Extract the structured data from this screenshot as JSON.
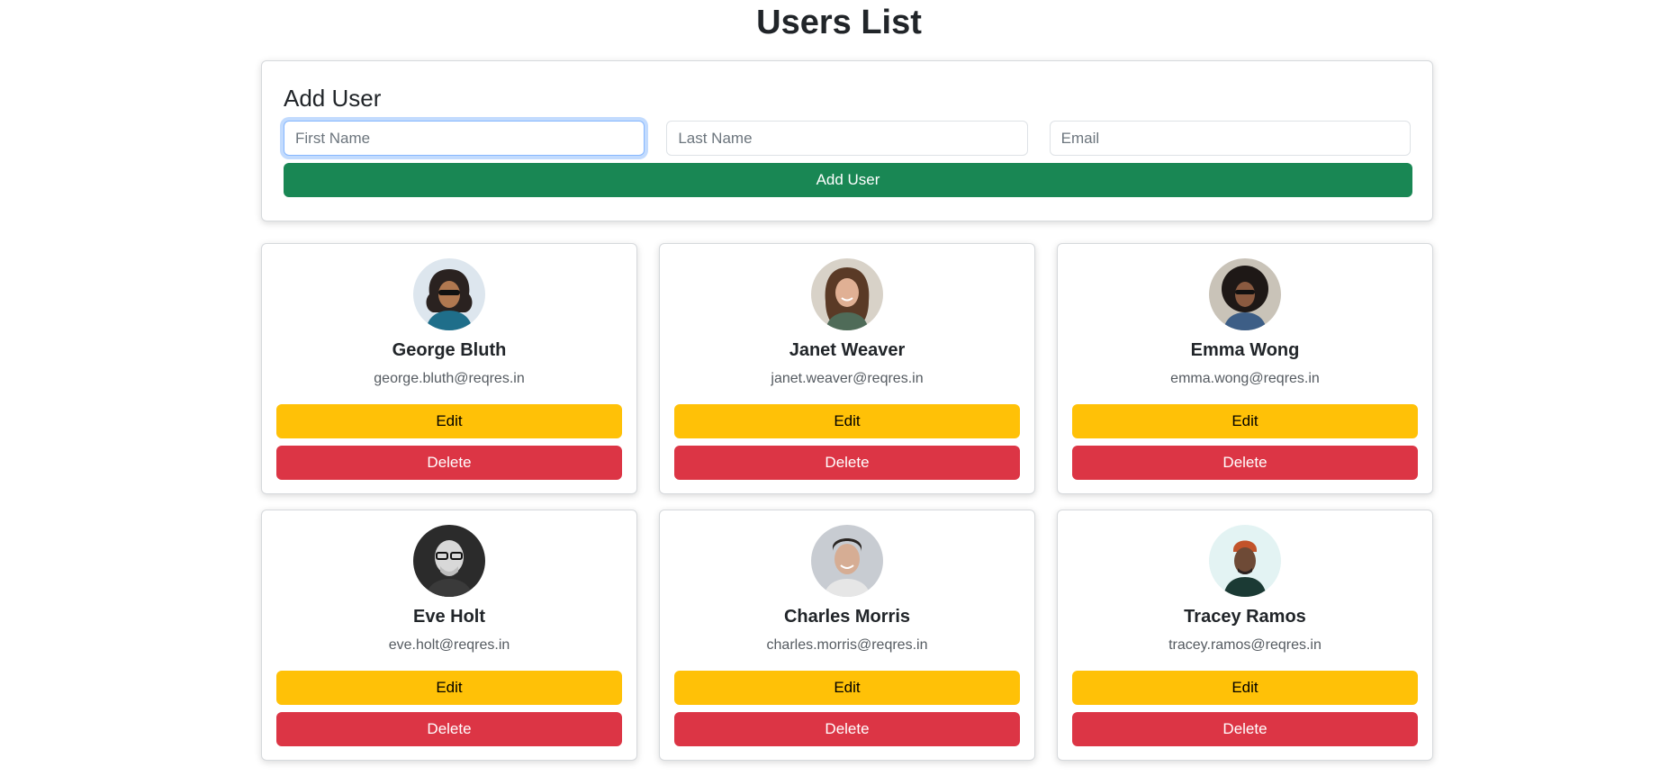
{
  "page": {
    "title": "Users List"
  },
  "add_user": {
    "title": "Add User",
    "first_name_placeholder": "First Name",
    "last_name_placeholder": "Last Name",
    "email_placeholder": "Email",
    "button_label": "Add User"
  },
  "users": [
    {
      "name": "George Bluth",
      "email": "george.bluth@reqres.in",
      "edit_label": "Edit",
      "delete_label": "Delete"
    },
    {
      "name": "Janet Weaver",
      "email": "janet.weaver@reqres.in",
      "edit_label": "Edit",
      "delete_label": "Delete"
    },
    {
      "name": "Emma Wong",
      "email": "emma.wong@reqres.in",
      "edit_label": "Edit",
      "delete_label": "Delete"
    },
    {
      "name": "Eve Holt",
      "email": "eve.holt@reqres.in",
      "edit_label": "Edit",
      "delete_label": "Delete"
    },
    {
      "name": "Charles Morris",
      "email": "charles.morris@reqres.in",
      "edit_label": "Edit",
      "delete_label": "Delete"
    },
    {
      "name": "Tracey Ramos",
      "email": "tracey.ramos@reqres.in",
      "edit_label": "Edit",
      "delete_label": "Delete"
    }
  ],
  "colors": {
    "add_button": "#198754",
    "edit_button": "#ffc107",
    "delete_button": "#dc3545",
    "focus_ring": "#86b7fe"
  }
}
